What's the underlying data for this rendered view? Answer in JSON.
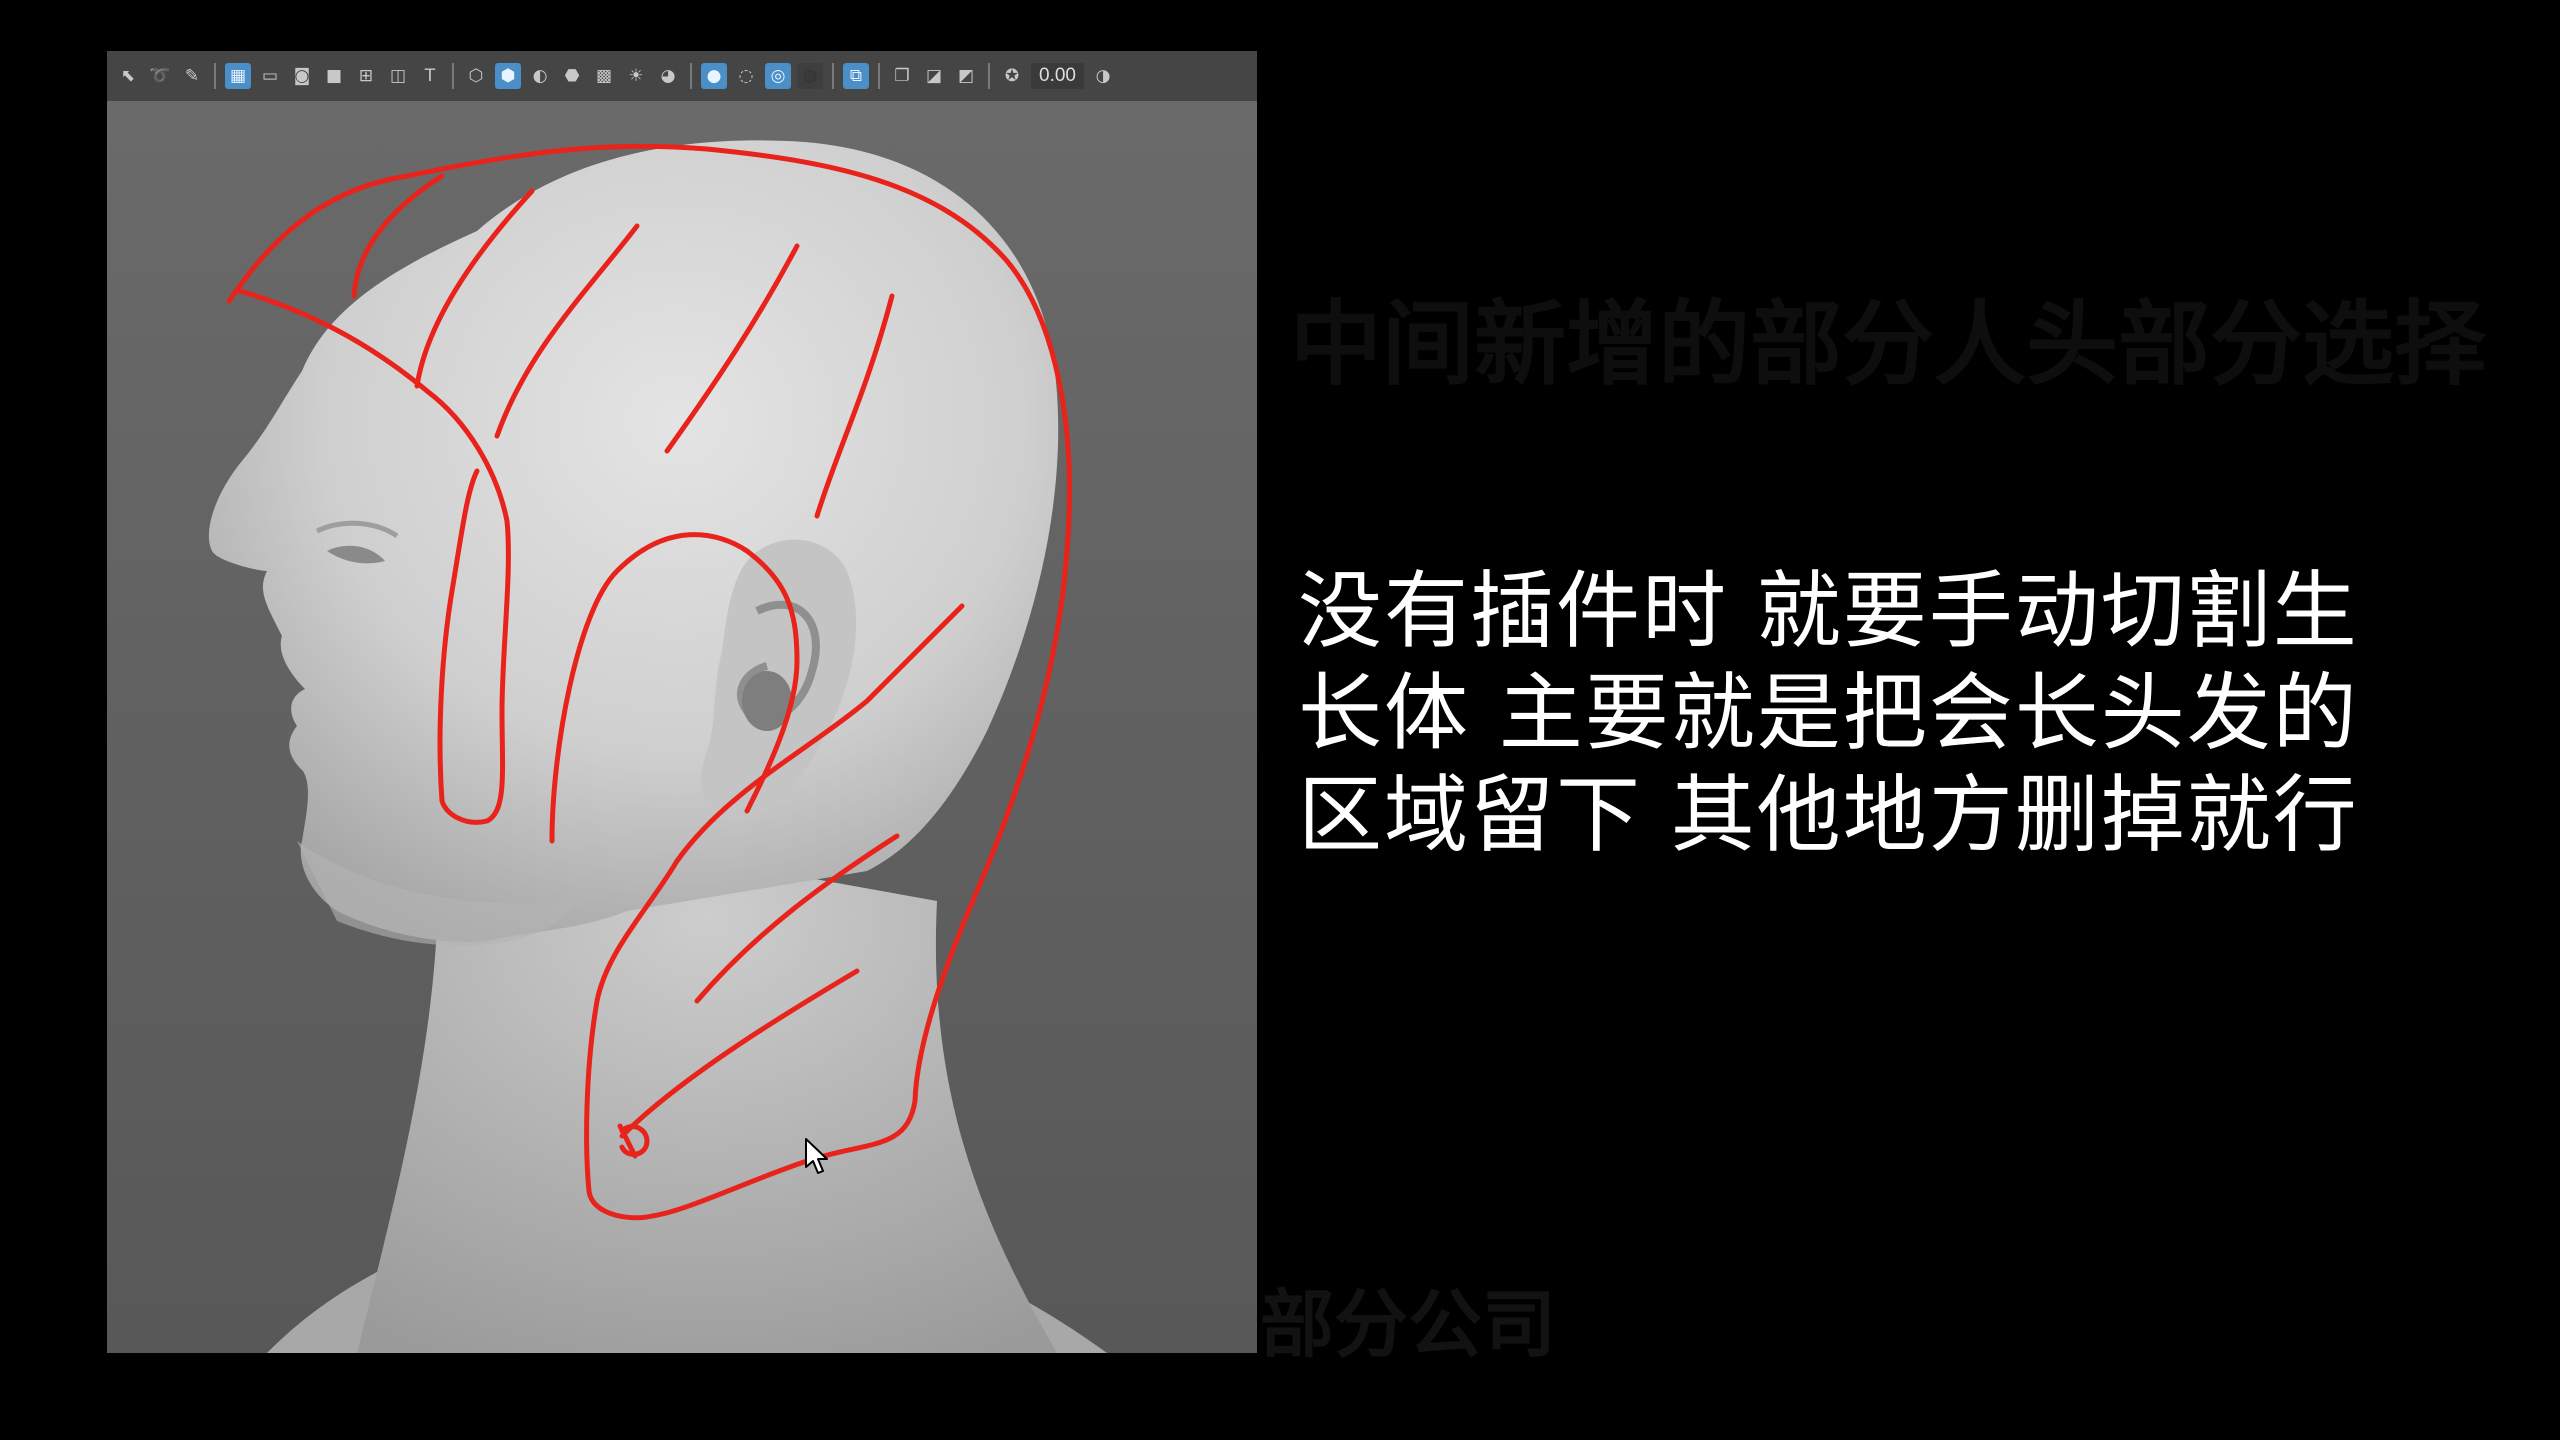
{
  "toolbar": {
    "value_field": "0.00",
    "icons": [
      "select-icon",
      "lasso-icon",
      "paint-icon",
      "sep",
      "grid-icon",
      "frame-icon",
      "film-gate-icon",
      "resolution-gate-icon",
      "safe-action-icon",
      "field-chart-icon",
      "safe-title-icon",
      "sep",
      "wireframe-icon",
      "smooth-shade-icon",
      "default-material-icon",
      "bounding-box-icon",
      "textured-icon",
      "use-all-lights-icon",
      "shadows-icon",
      "sep",
      "screen-space-ao-icon",
      "motion-blur-icon",
      "anti-aliasing-icon",
      "depth-of-field-icon",
      "sep",
      "isolate-select-icon",
      "sep",
      "xray-icon",
      "xray-joints-icon",
      "backface-culling-icon",
      "sep",
      "exposure-icon"
    ],
    "active_icons": [
      "grid-icon",
      "smooth-shade-icon",
      "screen-space-ao-icon",
      "anti-aliasing-icon",
      "isolate-select-icon"
    ]
  },
  "viewport": {
    "side_ticks": [
      "0",
      "0",
      "0",
      "0",
      "0"
    ],
    "annotation_color": "#e8231c"
  },
  "subtitle": {
    "lines": [
      "没有插件时  就要手动切割生",
      "长体  主要就是把会长头发的",
      "区域留下  其他地方删掉就行"
    ]
  },
  "ghost_text": {
    "top": "中间新增的部分人头部分选择",
    "bottom": "部分公司"
  }
}
